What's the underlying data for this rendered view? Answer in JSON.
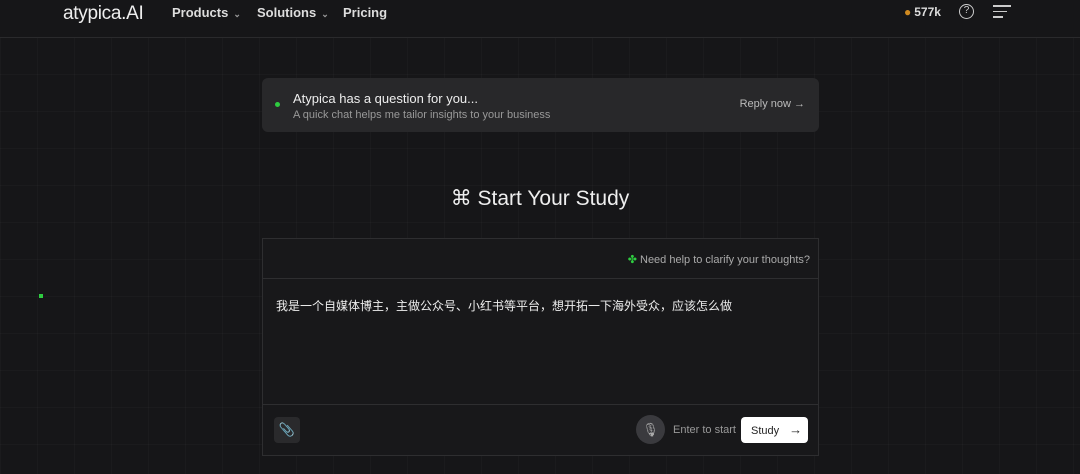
{
  "nav": {
    "logo": "atypica.AI",
    "products": "Products",
    "solutions": "Solutions",
    "pricing": "Pricing",
    "credits": "577k",
    "help_icon": "?"
  },
  "banner": {
    "title": "Atypica has a question for you...",
    "subtitle": "A quick chat helps me tailor insights to your business",
    "reply": "Reply now",
    "reply_icon": "→"
  },
  "main": {
    "heading": "⌘ Start Your Study",
    "help_link": "Need help to clarify your thoughts?",
    "input_value": "我是一个自媒体博主，主做公众号、小红书等平台，想开拓一下海外受众，应该怎么做",
    "enter_hint": "Enter to start",
    "study_label": "Study"
  }
}
